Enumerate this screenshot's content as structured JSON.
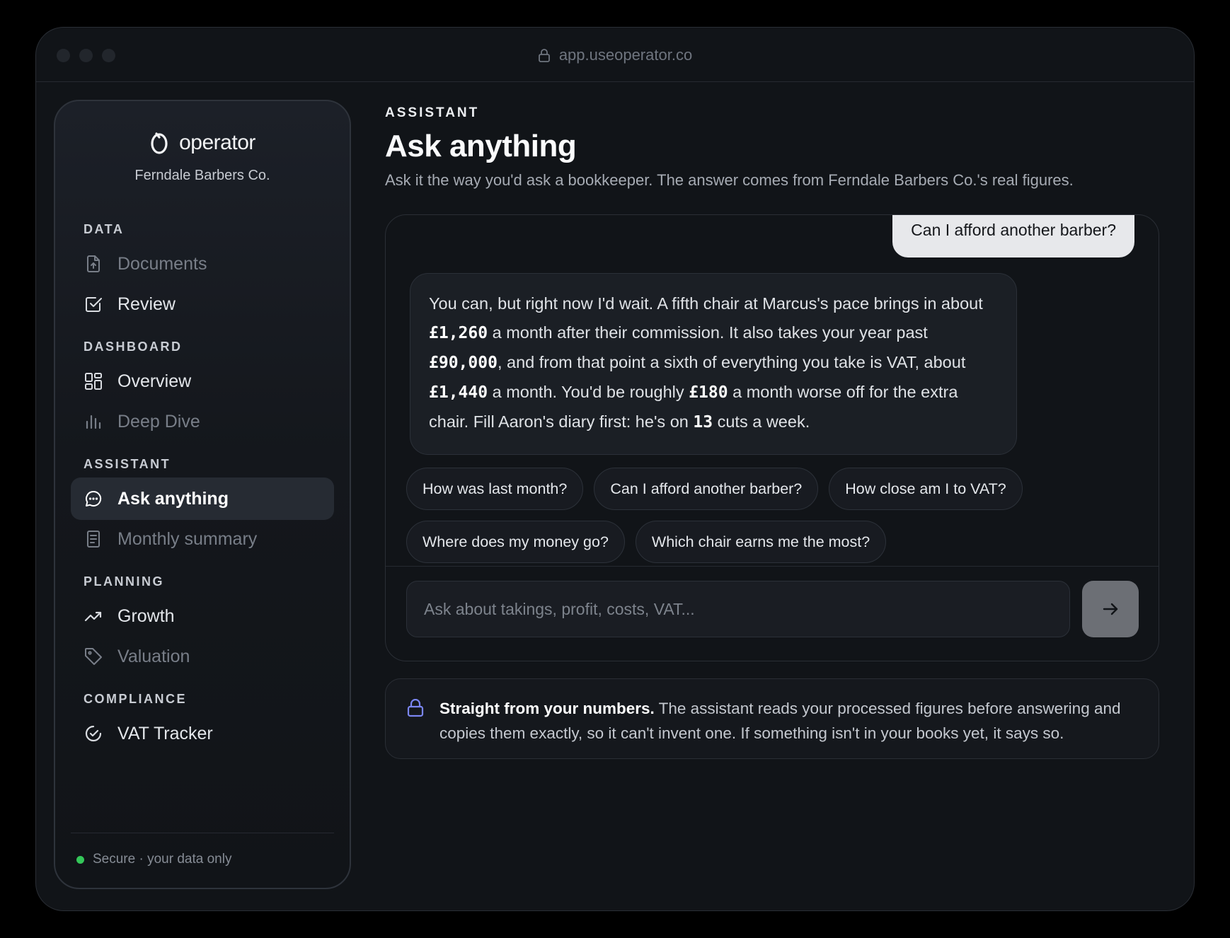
{
  "browser": {
    "url": "app.useoperator.co"
  },
  "sidebar": {
    "brand": "operator",
    "company": "Ferndale Barbers Co.",
    "sections": {
      "data": "DATA",
      "dashboard": "DASHBOARD",
      "assistant": "ASSISTANT",
      "planning": "PLANNING",
      "compliance": "COMPLIANCE"
    },
    "items": {
      "documents": "Documents",
      "review": "Review",
      "overview": "Overview",
      "deep_dive": "Deep Dive",
      "ask_anything": "Ask anything",
      "monthly_summary": "Monthly summary",
      "growth": "Growth",
      "valuation": "Valuation",
      "vat_tracker": "VAT Tracker"
    },
    "footer": "Secure · your data only"
  },
  "main": {
    "eyebrow": "ASSISTANT",
    "title": "Ask anything",
    "subtitle": "Ask it the way you'd ask a bookkeeper. The answer comes from Ferndale Barbers Co.'s real figures."
  },
  "chat": {
    "user_message": "Can I afford another barber?",
    "assistant_parts": [
      "You can, but right now I'd wait. A fifth chair at Marcus's pace brings in about ",
      "£1,260",
      " a month after their commission. It also takes your year past ",
      "£90,000",
      ", and from that point a sixth of everything you take is VAT, about ",
      "£1,440",
      " a month. You'd be roughly ",
      "£180",
      " a month worse off for the extra chair. Fill Aaron's diary first: he's on ",
      "13",
      " cuts a week."
    ],
    "suggestions": [
      "How was last month?",
      "Can I afford another barber?",
      "How close am I to VAT?",
      "Where does my money go?",
      "Which chair earns me the most?"
    ],
    "input_placeholder": "Ask about takings, profit, costs, VAT...",
    "input_value": ""
  },
  "notice": {
    "bold": "Straight from your numbers.",
    "text": " The assistant reads your processed figures before answering and copies them exactly, so it can't invent one. If something isn't in your books yet, it says so."
  },
  "colors": {
    "accent_lock": "#7b86f2",
    "secure_dot": "#34c759",
    "send_button": "#6c6f75"
  }
}
